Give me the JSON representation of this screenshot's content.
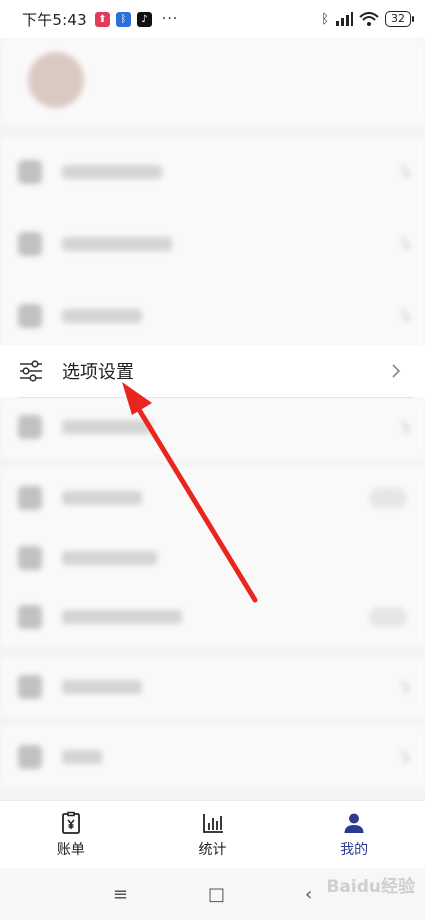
{
  "status_bar": {
    "time": "下午5:43",
    "battery": "32",
    "dots": "···"
  },
  "settings_row": {
    "label": "选项设置"
  },
  "tabbar": {
    "tabs": [
      {
        "label": "账单",
        "icon": "bill-icon"
      },
      {
        "label": "统计",
        "icon": "chart-icon"
      },
      {
        "label": "我的",
        "icon": "user-icon"
      }
    ],
    "active_index": 2,
    "active_color": "#2b3b8f"
  },
  "system_nav": {
    "menu": "≡",
    "home": "□",
    "back": "‹"
  },
  "watermark": "Baidu经验",
  "annotation_color": "#e8261f"
}
